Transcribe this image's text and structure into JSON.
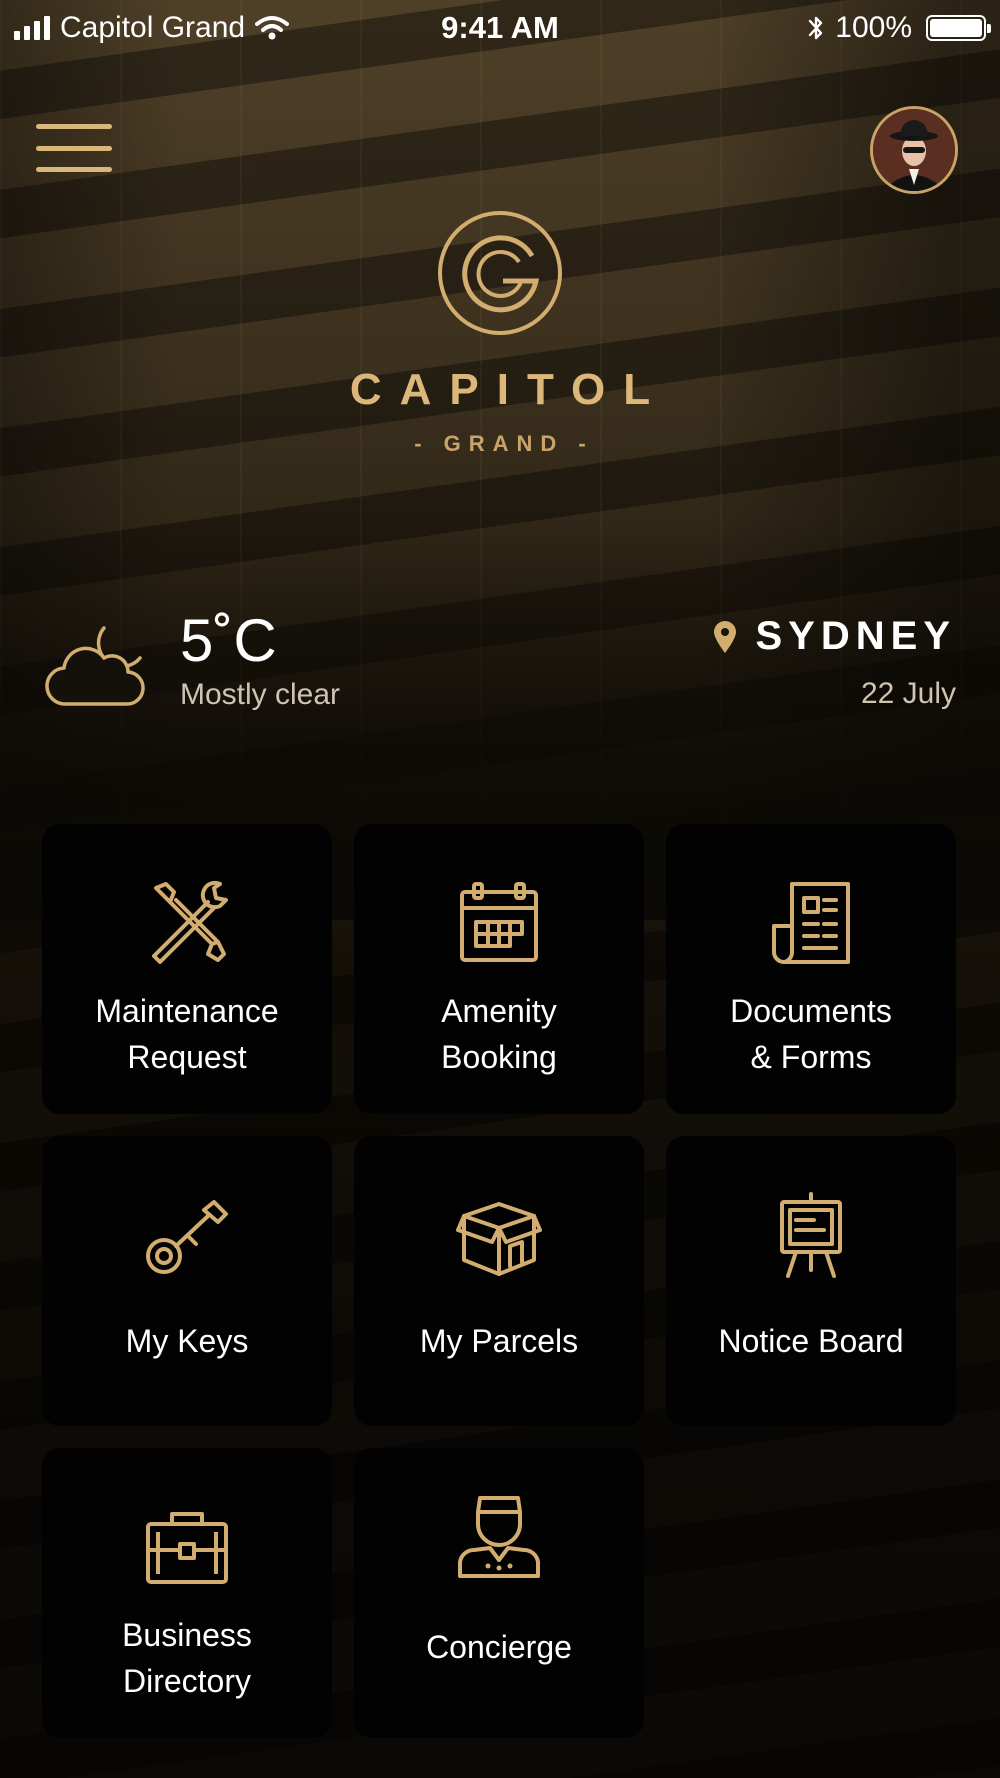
{
  "status_bar": {
    "carrier": "Capitol Grand",
    "time": "9:41 AM",
    "battery": "100%",
    "battery_level": 1.0
  },
  "header": {
    "menu_icon": "hamburger-menu-icon",
    "avatar_icon": "user-avatar"
  },
  "brand": {
    "logo_icon": "capitol-grand-logo",
    "name": "CAPITOL",
    "sub": "- GRAND -"
  },
  "weather": {
    "icon": "partly-cloudy-night-icon",
    "temperature": "5˚C",
    "condition": "Mostly clear"
  },
  "location": {
    "icon": "map-pin-icon",
    "city": "SYDNEY",
    "date": "22 July"
  },
  "tiles": [
    {
      "label_line1": "Maintenance",
      "label_line2": "Request",
      "icon": "tools-icon"
    },
    {
      "label_line1": "Amenity",
      "label_line2": "Booking",
      "icon": "calendar-icon"
    },
    {
      "label_line1": "Documents",
      "label_line2": "& Forms",
      "icon": "document-icon"
    },
    {
      "label": "My Keys",
      "icon": "key-icon"
    },
    {
      "label": "My Parcels",
      "icon": "parcel-box-icon"
    },
    {
      "label": "Notice Board",
      "icon": "notice-board-icon"
    },
    {
      "label_line1": "Business",
      "label_line2": "Directory",
      "icon": "briefcase-icon"
    },
    {
      "label": "Concierge",
      "icon": "concierge-icon"
    }
  ],
  "colors": {
    "accent_gold": "#d9b77a",
    "tile_bg": "#020202",
    "secondary_text": "#cfc4b2"
  }
}
